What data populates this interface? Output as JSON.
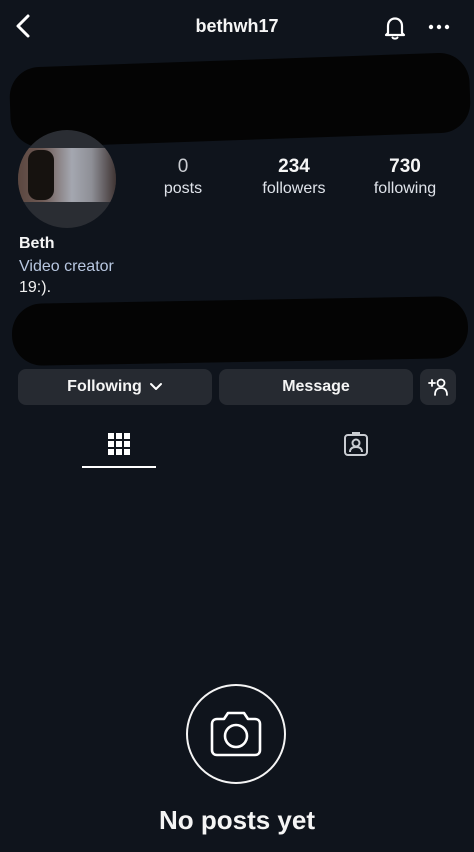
{
  "header": {
    "username": "bethwh17",
    "back_icon": "chevron-left-icon",
    "notification_icon": "bell-icon",
    "more_icon": "more-horizontal-icon"
  },
  "stats": {
    "posts": {
      "value": "0",
      "label": "posts"
    },
    "followers": {
      "value": "234",
      "label": "followers"
    },
    "following": {
      "value": "730",
      "label": "following"
    }
  },
  "profile": {
    "name": "Beth",
    "category": "Video creator",
    "bio": "19:)."
  },
  "actions": {
    "following_label": "Following",
    "message_label": "Message",
    "suggest_icon": "person-add-icon",
    "chevron_icon": "chevron-down-icon"
  },
  "tabs": [
    {
      "name": "grid",
      "icon": "grid-icon",
      "active": true
    },
    {
      "name": "tagged",
      "icon": "tagged-person-icon",
      "active": false
    }
  ],
  "empty_state": {
    "icon": "camera-icon",
    "title": "No posts yet"
  },
  "colors": {
    "background": "#0f141c",
    "button": "#262a31",
    "text": "#f5f5f5",
    "category": "#b8c7e0"
  }
}
